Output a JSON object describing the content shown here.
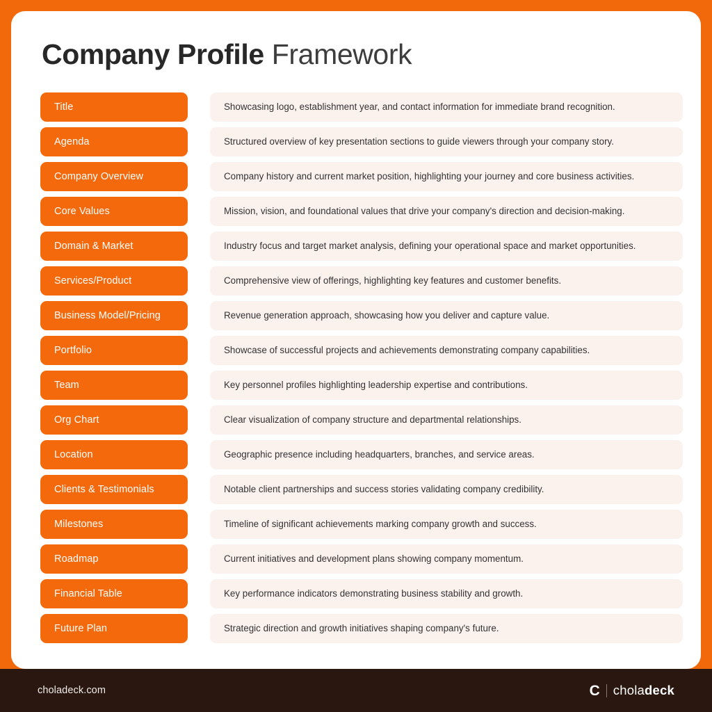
{
  "theme": {
    "frame_orange": "#f2690b",
    "pill_orange": "#f4690c",
    "desc_background": "#fbf1ed",
    "card_white": "#ffffff",
    "footer_dark": "#2a1710",
    "title_dark": "#282828"
  },
  "header": {
    "title_strong": "Company Profile",
    "title_light": " Framework"
  },
  "rows": [
    {
      "label": "Title",
      "description": "Showcasing logo, establishment year, and contact information for immediate brand recognition."
    },
    {
      "label": "Agenda",
      "description": "Structured overview of key presentation sections to guide viewers through your company story."
    },
    {
      "label": "Company Overview",
      "description": "Company history and current market position, highlighting your journey and core business activities."
    },
    {
      "label": "Core Values",
      "description": "Mission, vision, and foundational values that drive your company's direction and decision-making."
    },
    {
      "label": "Domain & Market",
      "description": "Industry focus and target market analysis, defining your operational space and market opportunities."
    },
    {
      "label": "Services/Product",
      "description": "Comprehensive view of offerings, highlighting key features and customer benefits."
    },
    {
      "label": "Business Model/Pricing",
      "description": "Revenue generation approach, showcasing how you deliver and capture value."
    },
    {
      "label": "Portfolio",
      "description": "Showcase of successful projects and achievements demonstrating company capabilities."
    },
    {
      "label": "Team",
      "description": "Key personnel profiles highlighting leadership expertise and contributions."
    },
    {
      "label": "Org Chart",
      "description": "Clear visualization of company structure and departmental relationships."
    },
    {
      "label": "Location",
      "description": "Geographic presence including headquarters, branches, and service areas."
    },
    {
      "label": "Clients & Testimonials",
      "description": "Notable client partnerships and success stories validating company credibility."
    },
    {
      "label": "Milestones",
      "description": "Timeline of significant achievements marking company growth and success."
    },
    {
      "label": "Roadmap",
      "description": "Current initiatives and development plans showing company momentum."
    },
    {
      "label": "Financial Table",
      "description": "Key performance indicators demonstrating business stability and growth."
    },
    {
      "label": "Future Plan",
      "description": "Strategic direction and growth initiatives shaping company's future."
    }
  ],
  "footer": {
    "url": "choladeck.com",
    "logo_mark": "C",
    "logo_word_light": "chola",
    "logo_word_bold": "deck"
  }
}
